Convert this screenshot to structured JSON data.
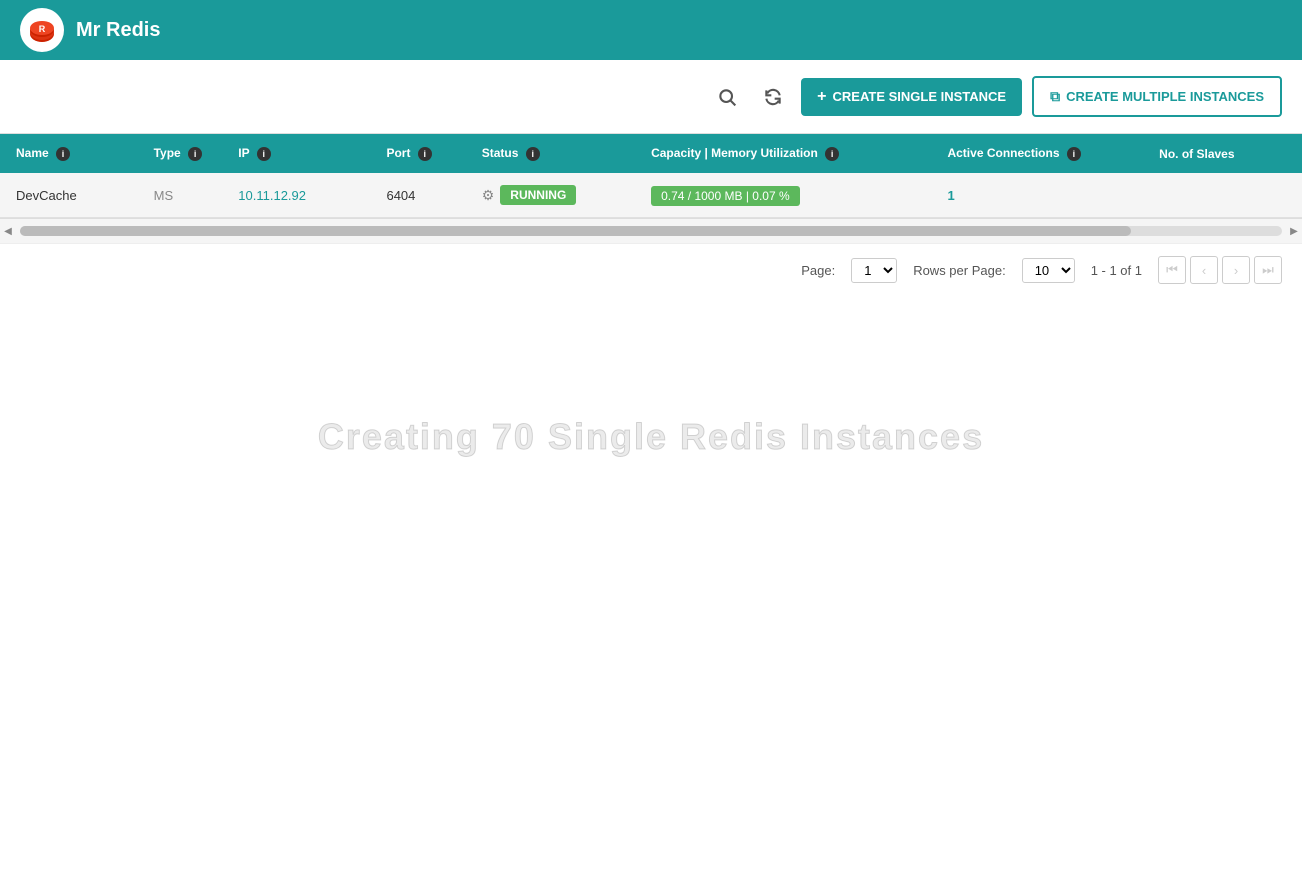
{
  "header": {
    "logo_emoji": "🔴",
    "title": "Mr Redis"
  },
  "toolbar": {
    "search_label": "🔍",
    "refresh_label": "↻",
    "create_single_label": "CREATE SINGLE INSTANCE",
    "create_multiple_label": "CREATE MULTIPLE INSTANCES"
  },
  "table": {
    "columns": [
      {
        "key": "name",
        "label": "Name"
      },
      {
        "key": "type",
        "label": "Type"
      },
      {
        "key": "ip",
        "label": "IP"
      },
      {
        "key": "port",
        "label": "Port"
      },
      {
        "key": "status",
        "label": "Status"
      },
      {
        "key": "capacity",
        "label": "Capacity | Memory Utilization"
      },
      {
        "key": "connections",
        "label": "Active Connections"
      },
      {
        "key": "slaves",
        "label": "No. of Slaves"
      }
    ],
    "rows": [
      {
        "name": "DevCache",
        "type": "MS",
        "ip": "10.11.12.92",
        "port": "6404",
        "status": "RUNNING",
        "capacity": "0.74 / 1000 MB | 0.07 %",
        "connections": "1",
        "slaves": ""
      }
    ]
  },
  "pagination": {
    "page_label": "Page:",
    "page_value": "1",
    "rows_per_page_label": "Rows per Page:",
    "rows_per_page_value": "10",
    "range_label": "1 - 1 of 1"
  },
  "watermark": {
    "text": "Creating 70 Single Redis Instances"
  },
  "colors": {
    "teal": "#1a9a9a",
    "green": "#5cb85c",
    "white": "#ffffff"
  }
}
